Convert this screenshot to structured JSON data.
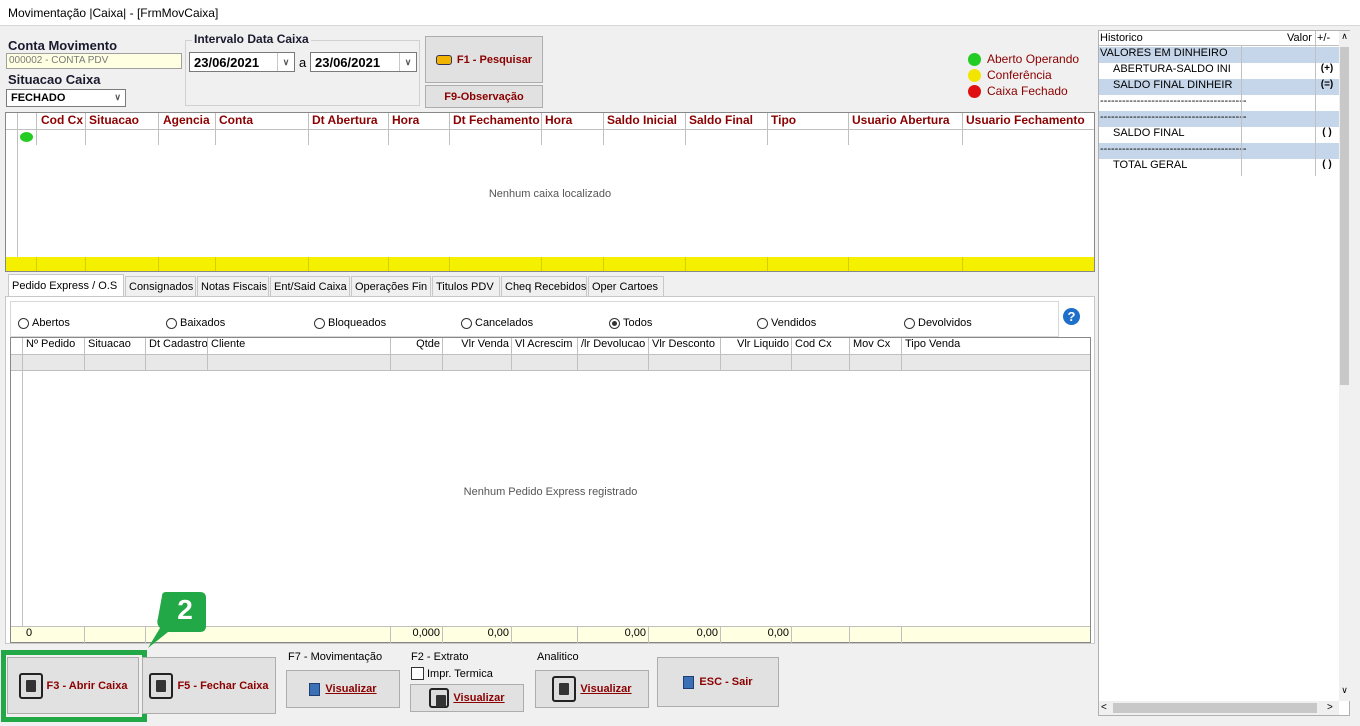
{
  "window": {
    "title": "Movimentação |Caixa| - [FrmMovCaixa]"
  },
  "filters": {
    "conta_label": "Conta Movimento",
    "conta_value": "000002 - CONTA PDV",
    "situacao_label": "Situacao Caixa",
    "situacao_value": "FECHADO",
    "intervalo_label": "Intervalo Data Caixa",
    "date_from": "23/06/2021",
    "date_sep": "a",
    "date_to": "23/06/2021",
    "search_btn": "F1 - Pesquisar",
    "obs_btn": "F9-Observação"
  },
  "legend": {
    "items": [
      {
        "label": "Aberto Operando",
        "color": "#22cc22"
      },
      {
        "label": "Conferência",
        "color": "#f2e600"
      },
      {
        "label": "Caixa Fechado",
        "color": "#e01010"
      }
    ]
  },
  "caixa_grid": {
    "columns": [
      "Cod Cx",
      "Situacao",
      "Agencia",
      "Conta",
      "Dt Abertura",
      "Hora",
      "Dt Fechamento",
      "Hora",
      "Saldo Inicial",
      "Saldo Final",
      "Tipo",
      "Usuario Abertura",
      "Usuario Fechamento"
    ],
    "empty": "Nenhum caixa localizado"
  },
  "tabs": [
    "Pedido Express / O.S",
    "Consignados",
    "Notas Fiscais",
    "Ent/Said Caixa",
    "Operações Fin",
    "Titulos PDV",
    "Cheq Recebidos",
    "Oper Cartoes"
  ],
  "radios": {
    "options": [
      "Abertos",
      "Baixados",
      "Bloqueados",
      "Cancelados",
      "Todos",
      "Vendidos",
      "Devolvidos"
    ],
    "selected": "Todos"
  },
  "pedidos_grid": {
    "columns": [
      "Nº Pedido",
      "Situacao",
      "Dt Cadastro",
      "Cliente",
      "Qtde",
      "Vlr Venda",
      "Vl Acrescim",
      "/lr Devolucao",
      "Vlr Desconto",
      "Vlr Liquido",
      "Cod Cx",
      "Mov Cx",
      "Tipo Venda"
    ],
    "empty": "Nenhum Pedido Express registrado",
    "footer": {
      "pedido": "0",
      "qtde": "0,000",
      "venda": "0,00",
      "devolucao": "0,00",
      "desconto": "0,00",
      "liquido": "0,00"
    }
  },
  "bottom": {
    "abrir": "F3 - Abrir Caixa",
    "fechar": "F5 - Fechar Caixa",
    "mov_label": "F7 - Movimentação",
    "mov_btn": "Visualizar",
    "extrato_label": "F2 - Extrato",
    "impr_label": "Impr. Termica",
    "extrato_btn": "Visualizar",
    "analitico_label": "Analitico",
    "analitico_btn": "Visualizar",
    "sair_btn": "ESC - Sair"
  },
  "step_badge": "2",
  "historico": {
    "col_hist": "Historico",
    "col_valor": "Valor",
    "col_sign": "+/-",
    "rows": [
      {
        "text": "VALORES EM DINHEIRO",
        "sign": "",
        "bg": "#c5d6ea",
        "indent": false
      },
      {
        "text": "ABERTURA-SALDO INI",
        "sign": "(+)",
        "bg": "#ffffff",
        "indent": true
      },
      {
        "text": "SALDO FINAL DINHEIR",
        "sign": "(=)",
        "bg": "#c5d6ea",
        "indent": true
      },
      {
        "text": "----------------------------------------",
        "sign": "",
        "bg": "#ffffff",
        "indent": false
      },
      {
        "text": "----------------------------------------",
        "sign": "",
        "bg": "#c5d6ea",
        "indent": false
      },
      {
        "text": "SALDO FINAL",
        "sign": "( )",
        "bg": "#ffffff",
        "indent": true
      },
      {
        "text": "----------------------------------------",
        "sign": "",
        "bg": "#c5d6ea",
        "indent": false
      },
      {
        "text": "TOTAL GERAL",
        "sign": "( )",
        "bg": "#ffffff",
        "indent": true
      }
    ]
  },
  "colors": {
    "accent_red": "#8b0000",
    "highlight_green": "#22a846",
    "grid_yellow": "#f5f000",
    "panel_yellow": "#ffffe1"
  }
}
